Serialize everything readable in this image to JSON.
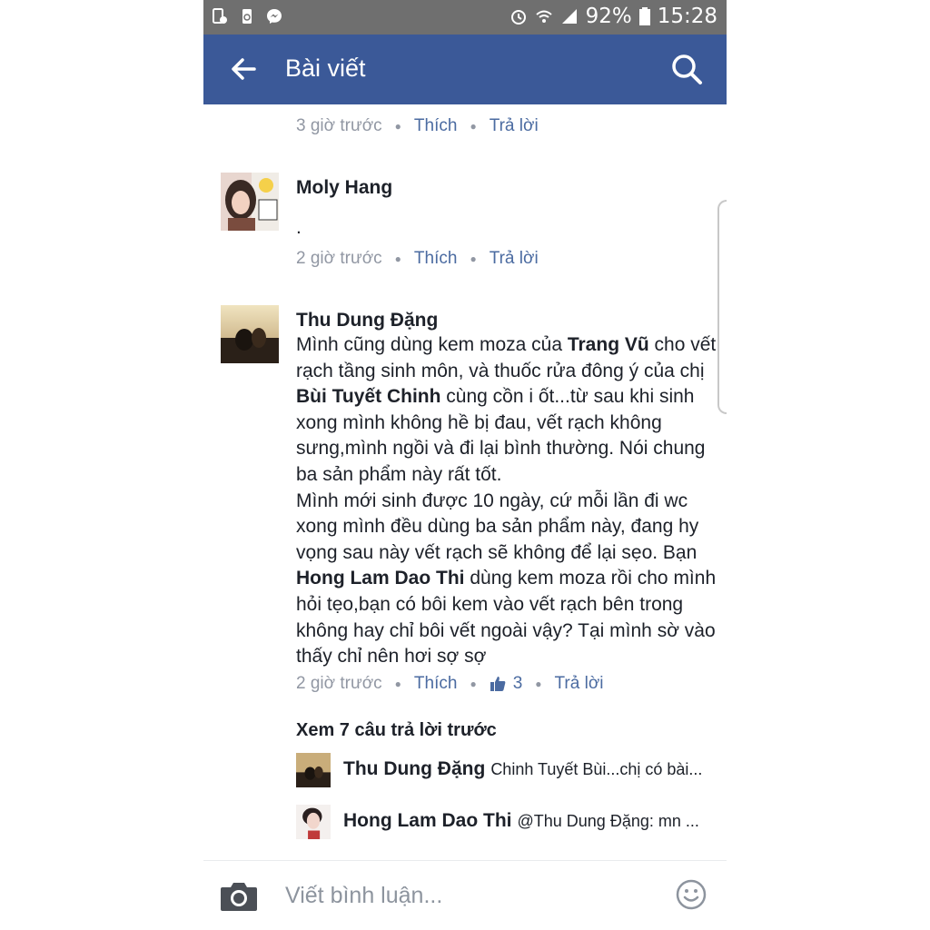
{
  "status_bar": {
    "battery": "92%",
    "time": "15:28",
    "left_icons": [
      "device-icon",
      "recycle-icon",
      "messenger-icon"
    ],
    "right_icons": [
      "alarm-icon",
      "wifi-icon",
      "signal-icon",
      "battery-icon"
    ]
  },
  "app_bar": {
    "title": "Bài viết",
    "back_icon": "arrow-left-icon",
    "search_icon": "search-icon",
    "color": "#3b5998"
  },
  "comments": [
    {
      "time": "3 giờ trước",
      "like_label": "Thích",
      "reply_label": "Trả lời"
    },
    {
      "author": "Moly Hang",
      "text": ".",
      "time": "2 giờ trước",
      "like_label": "Thích",
      "reply_label": "Trả lời"
    },
    {
      "author": "Thu Dung Đặng",
      "text_parts": [
        "Mình cũng dùng kem moza của ",
        "Trang Vũ",
        " cho vết rạch tầng sinh môn, và thuốc rửa đông ý của chị ",
        "Bùi Tuyết Chinh",
        " cùng cồn i ốt...từ sau khi sinh xong mình không hề bị đau, vết rạch không sưng,mình ngồi và đi lại bình thường. Nói chung ba sản phẩm này rất tốt.",
        "Mình mới sinh được 10 ngày, cứ mỗi lần đi wc xong mình đều dùng ba sản phẩm này, đang hy vọng sau này vết rạch sẽ không để lại sẹo. Bạn ",
        "Hong Lam Dao Thi",
        " dùng kem moza rồi cho mình hỏi tẹo,bạn có bôi kem vào vết rạch bên trong không hay chỉ bôi vết ngoài vậy? Tại mình sờ vào thấy chỉ nên hơi sợ sợ"
      ],
      "time": "2 giờ trước",
      "like_label": "Thích",
      "like_count": "3",
      "reply_label": "Trả lời",
      "see_more": "Xem 7 câu trả lời trước",
      "replies": [
        {
          "author": "Thu Dung Đặng",
          "text": "Chinh Tuyết Bùi...chị có bài..."
        },
        {
          "author": "Hong Lam Dao Thi",
          "text": "@Thu Dung Đặng: mn ..."
        }
      ]
    }
  ],
  "composer": {
    "placeholder": "Viết bình luận...",
    "camera_icon": "camera-icon",
    "emoji_icon": "smiley-icon"
  },
  "colors": {
    "link": "#4b6ba1",
    "meta": "#9197a3",
    "text": "#1d2129"
  }
}
